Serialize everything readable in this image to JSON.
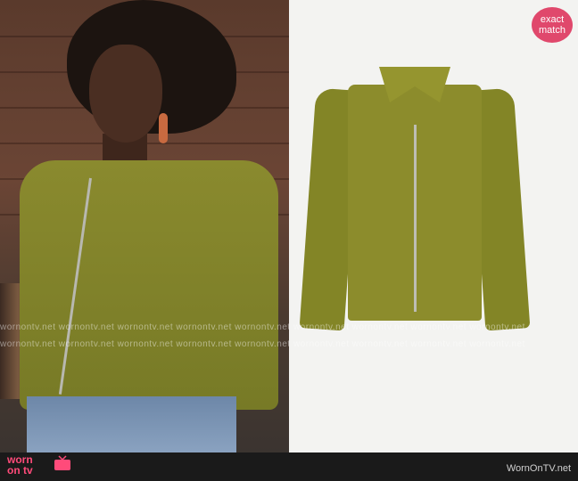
{
  "badge": {
    "line1": "exact",
    "line2": "match"
  },
  "watermark_row": "wornontv.net   wornontv.net   wornontv.net   wornontv.net   wornontv.net   wornontv.net   wornontv.net   wornontv.net   wornontv.net",
  "footer": {
    "brand_line1": "worn",
    "brand_line2": "on tv",
    "site": "WornOnTV.net"
  }
}
